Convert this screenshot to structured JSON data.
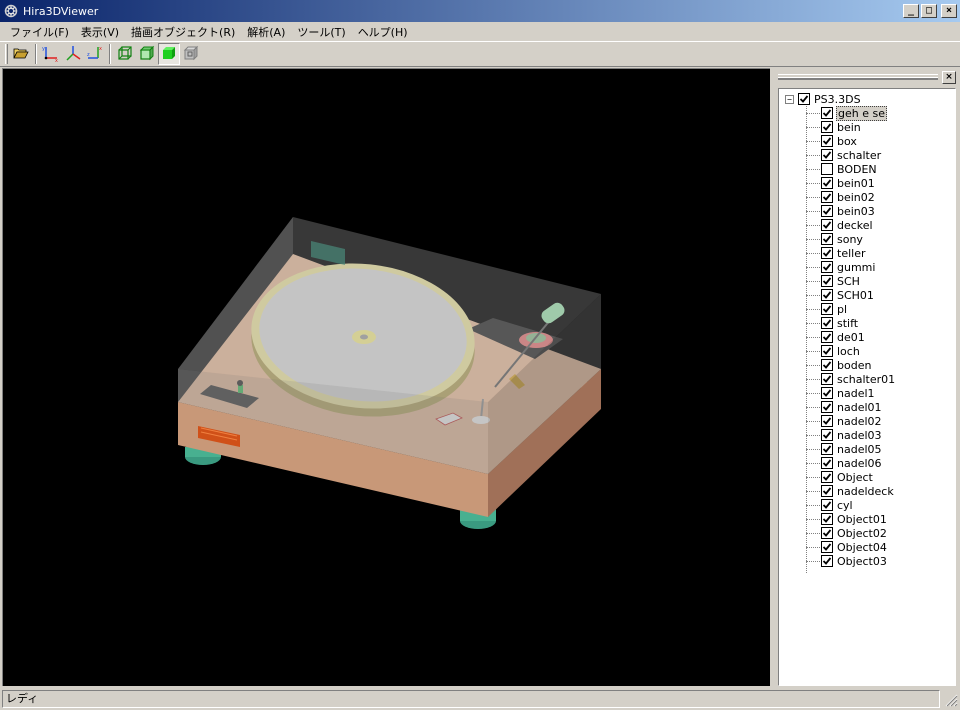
{
  "window": {
    "title": "Hira3DViewer",
    "icon": "app-logo-icon"
  },
  "menu": [
    {
      "id": "file",
      "label": "ファイル(F)"
    },
    {
      "id": "view",
      "label": "表示(V)"
    },
    {
      "id": "draw-object",
      "label": "描画オブジェクト(R)"
    },
    {
      "id": "analysis",
      "label": "解析(A)"
    },
    {
      "id": "tools",
      "label": "ツール(T)"
    },
    {
      "id": "help",
      "label": "ヘルプ(H)"
    }
  ],
  "toolbar": {
    "buttons": [
      {
        "name": "open-folder-icon"
      },
      {
        "name": "axis-xy-icon"
      },
      {
        "name": "axis-xyz-icon"
      },
      {
        "name": "axis-zx-icon"
      },
      {
        "name": "wireframe-cube-icon"
      },
      {
        "name": "shaded-cube-icon"
      },
      {
        "name": "solid-cube-icon",
        "pressed": true
      },
      {
        "name": "transparent-cube-icon"
      }
    ]
  },
  "tree": {
    "root": {
      "label": "PS3.3DS",
      "checked": true
    },
    "items": [
      {
        "label": "geh e se",
        "checked": true,
        "selected": true
      },
      {
        "label": "bein",
        "checked": true
      },
      {
        "label": "box",
        "checked": true
      },
      {
        "label": "schalter",
        "checked": true
      },
      {
        "label": "BODEN",
        "checked": false
      },
      {
        "label": "bein01",
        "checked": true
      },
      {
        "label": "bein02",
        "checked": true
      },
      {
        "label": "bein03",
        "checked": true
      },
      {
        "label": "deckel",
        "checked": true
      },
      {
        "label": "sony",
        "checked": true
      },
      {
        "label": "teller",
        "checked": true
      },
      {
        "label": "gummi",
        "checked": true
      },
      {
        "label": "SCH",
        "checked": true
      },
      {
        "label": "SCH01",
        "checked": true
      },
      {
        "label": "pl",
        "checked": true
      },
      {
        "label": "stift",
        "checked": true
      },
      {
        "label": "de01",
        "checked": true
      },
      {
        "label": "loch",
        "checked": true
      },
      {
        "label": "boden",
        "checked": true
      },
      {
        "label": "schalter01",
        "checked": true
      },
      {
        "label": "nadel1",
        "checked": true
      },
      {
        "label": "nadel01",
        "checked": true
      },
      {
        "label": "nadel02",
        "checked": true
      },
      {
        "label": "nadel03",
        "checked": true
      },
      {
        "label": "nadel05",
        "checked": true
      },
      {
        "label": "nadel06",
        "checked": true
      },
      {
        "label": "Object",
        "checked": true
      },
      {
        "label": "nadeldeck",
        "checked": true
      },
      {
        "label": "cyl",
        "checked": true
      },
      {
        "label": "Object01",
        "checked": true
      },
      {
        "label": "Object02",
        "checked": true
      },
      {
        "label": "Object04",
        "checked": true
      },
      {
        "label": "Object03",
        "checked": true
      }
    ]
  },
  "status": {
    "text": "レディ"
  }
}
